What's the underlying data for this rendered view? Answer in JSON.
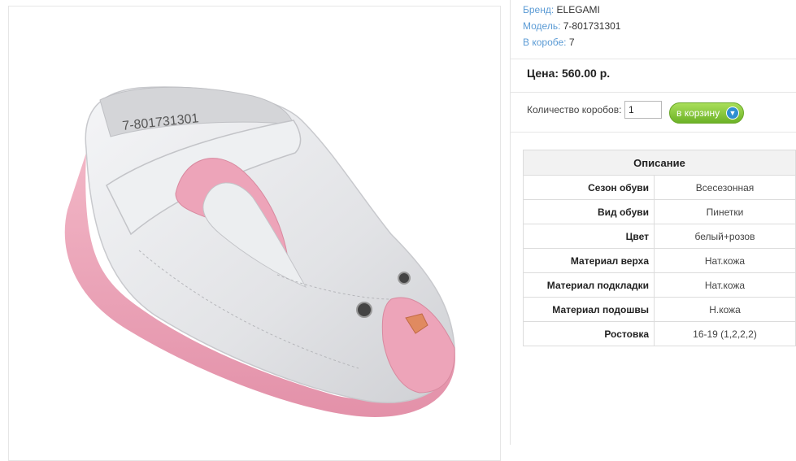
{
  "product": {
    "brand_label": "Бренд:",
    "brand_value": "ELEGAMI",
    "model_label": "Модель:",
    "model_value": "7-801731301",
    "box_label": "В коробе:",
    "box_value": "7",
    "price": "Цена: 560.00 р."
  },
  "order": {
    "qty_label": "Количество коробов:",
    "qty_value": "1",
    "cart_label": "в корзину",
    "cart_icon": "cart-icon"
  },
  "specs": {
    "title": "Описание",
    "rows": [
      {
        "name": "Сезон обуви",
        "value": "Всесезонная"
      },
      {
        "name": "Вид обуви",
        "value": "Пинетки"
      },
      {
        "name": "Цвет",
        "value": "белый+розов"
      },
      {
        "name": "Материал верха",
        "value": "Нат.кожа"
      },
      {
        "name": "Материал подкладки",
        "value": "Нат.кожа"
      },
      {
        "name": "Материал подошвы",
        "value": "Н.кожа"
      },
      {
        "name": "Ростовка",
        "value": "16-19 (1,2,2,2)"
      }
    ]
  },
  "photo": {
    "insole_print": "7-801731301"
  },
  "colors": {
    "link": "#5b9bd5",
    "shoe_white": "#e9eaec",
    "shoe_pink": "#eda4b9",
    "button_green": "#7cc234"
  }
}
